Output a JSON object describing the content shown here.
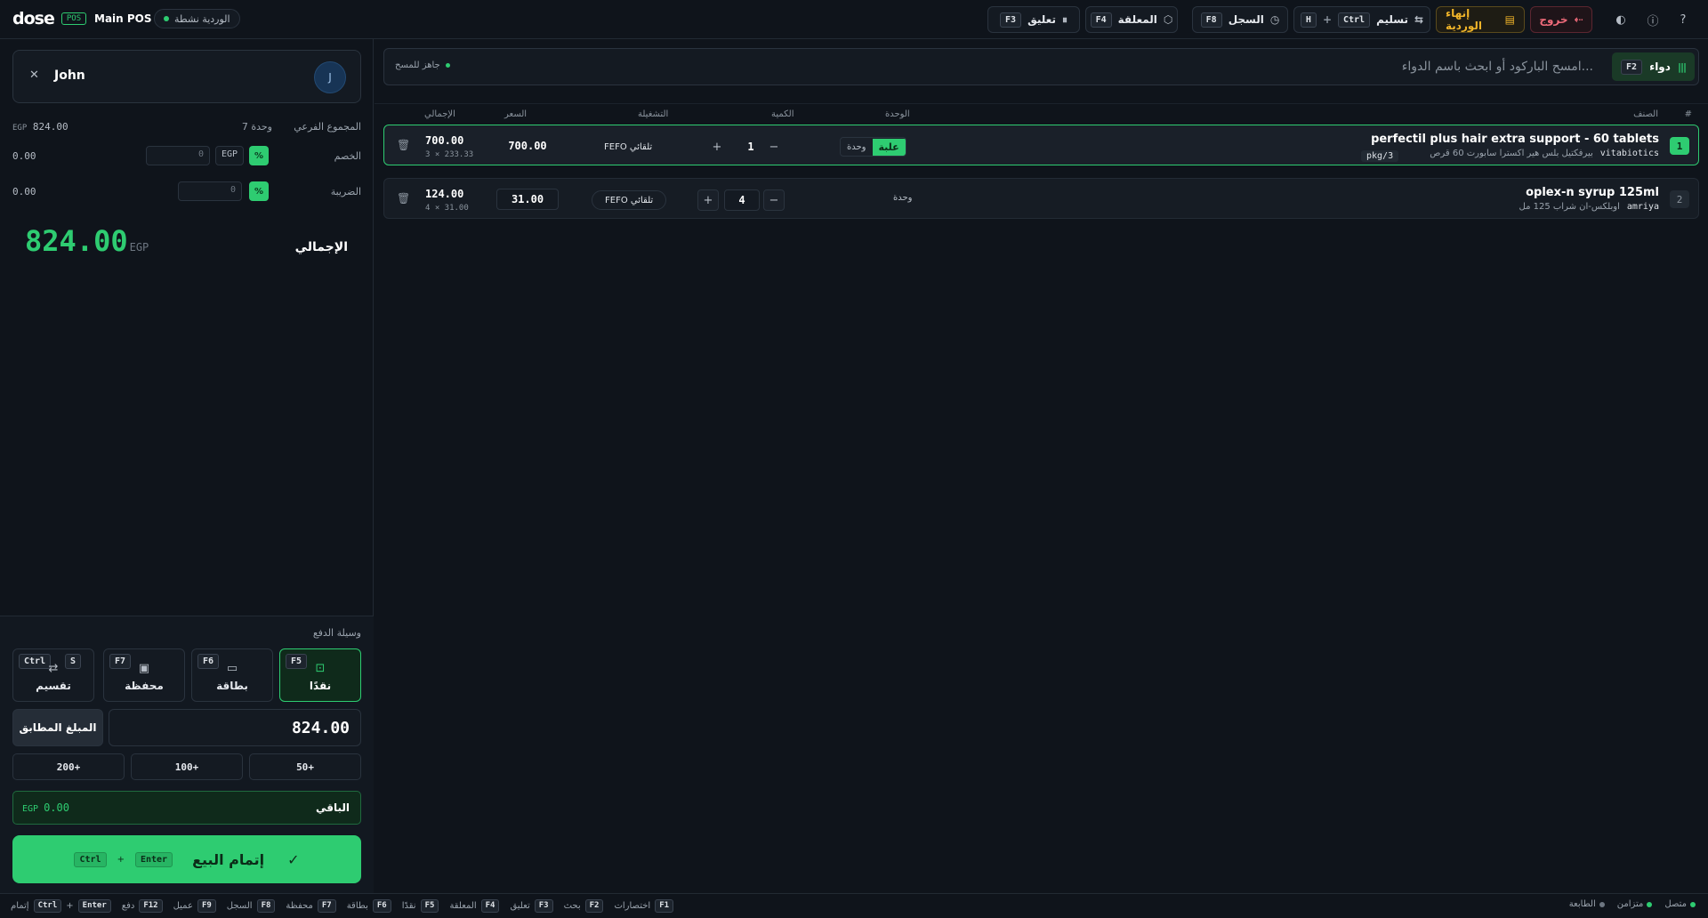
{
  "topbar": {
    "brand": "dose",
    "brand_badge": "POS",
    "pos_name": "Main POS",
    "shift_status": "الوردية نشطة",
    "buttons": {
      "suspend": {
        "label": "تعليق",
        "key": "F3"
      },
      "pending": {
        "label": "المعلقة",
        "key": "F4"
      },
      "history": {
        "label": "السجل",
        "key": "F8"
      },
      "handover": {
        "label": "تسليم",
        "key1": "Ctrl",
        "key2": "H",
        "plus": "+"
      },
      "end_shift": {
        "label": "إنهاء الوردية"
      },
      "logout": {
        "label": "خروج"
      }
    },
    "icons": [
      "palette-icon",
      "info-icon",
      "help-icon"
    ]
  },
  "customer": {
    "name": "John",
    "avatar_initial": "J"
  },
  "summary": {
    "subtotal_label": "المجموع الفرعي",
    "units_text": "7 وحدة",
    "subtotal_value": "824.00",
    "currency": "EGP",
    "discount_label": "الخصم",
    "discount_value": "0.00",
    "discount_input": "0",
    "tax_label": "الضريبة",
    "tax_value": "0.00",
    "tax_input": "0",
    "pct_symbol": "%",
    "total_label": "الإجمالي",
    "total_value": "824.00"
  },
  "payment": {
    "title": "وسيلة الدفع",
    "methods": [
      {
        "label": "نقدًا",
        "key": "F5",
        "icon": "cash-icon",
        "glyph": "⊡"
      },
      {
        "label": "بطاقة",
        "key": "F6",
        "icon": "card-icon",
        "glyph": "▭"
      },
      {
        "label": "محفظة",
        "key": "F7",
        "icon": "wallet-icon",
        "glyph": "▣"
      },
      {
        "label": "تقسيم",
        "key": "Ctrl",
        "key2": "S",
        "icon": "split-icon",
        "glyph": "⇄"
      }
    ],
    "exact_label": "المبلغ المطابق",
    "amount": "824.00",
    "quick": [
      "+50",
      "+100",
      "+200"
    ],
    "remaining_label": "الباقي",
    "remaining_value": "0.00",
    "complete_label": "إتمام البيع",
    "complete_key1": "Ctrl",
    "complete_key2": "Enter",
    "plus": "+"
  },
  "search": {
    "type_label": "دواء",
    "type_key": "F2",
    "placeholder": "امسح الباركود أو ابحث باسم الدواء...",
    "scan_status": "جاهز للمسح"
  },
  "grid": {
    "headers": {
      "index": "#",
      "item": "الصنف",
      "unit": "الوحدة",
      "qty": "الكمية",
      "batch": "التشغيلة",
      "price": "السعر",
      "total": "الإجمالي"
    },
    "rows": [
      {
        "index": "1",
        "name": "perfectil plus hair extra support - 60 tablets",
        "arabic": "بيرفكتيل بلس هير اكسترا سابورت 60 قرص",
        "manufacturer": "vitabiotics",
        "pkg": "pkg/3",
        "unit_box": "علبة",
        "unit_unit": "وحدة",
        "qty": "1",
        "batch": "FEFO تلقائي",
        "price": "700.00",
        "total": "700.00",
        "sub": "3 × 233.33"
      },
      {
        "index": "2",
        "name": "oplex-n syrup 125ml",
        "arabic": "اوبلكس-ان شراب 125 مل",
        "manufacturer": "amriya",
        "unit_plain": "وحدة",
        "qty": "4",
        "batch": "FEFO تلقائي",
        "price": "31.00",
        "total": "124.00",
        "sub": "4 × 31.00"
      }
    ]
  },
  "statusbar": {
    "shortcuts": [
      {
        "key": "F1",
        "label": "اختصارات"
      },
      {
        "key": "F2",
        "label": "بحث"
      },
      {
        "key": "F3",
        "label": "تعليق"
      },
      {
        "key": "F4",
        "label": "المعلقة"
      },
      {
        "key": "F5",
        "label": "نقدًا"
      },
      {
        "key": "F6",
        "label": "بطاقة"
      },
      {
        "key": "F7",
        "label": "محفظة"
      },
      {
        "key": "F8",
        "label": "السجل"
      },
      {
        "key": "F9",
        "label": "عميل"
      },
      {
        "key": "F12",
        "label": "دفع"
      }
    ],
    "complete_key1": "Ctrl",
    "complete_key2": "Enter",
    "complete_label": "إتمام",
    "plus": "+",
    "connected": "متصل",
    "synced": "متزامن",
    "printer": "الطابعة"
  }
}
